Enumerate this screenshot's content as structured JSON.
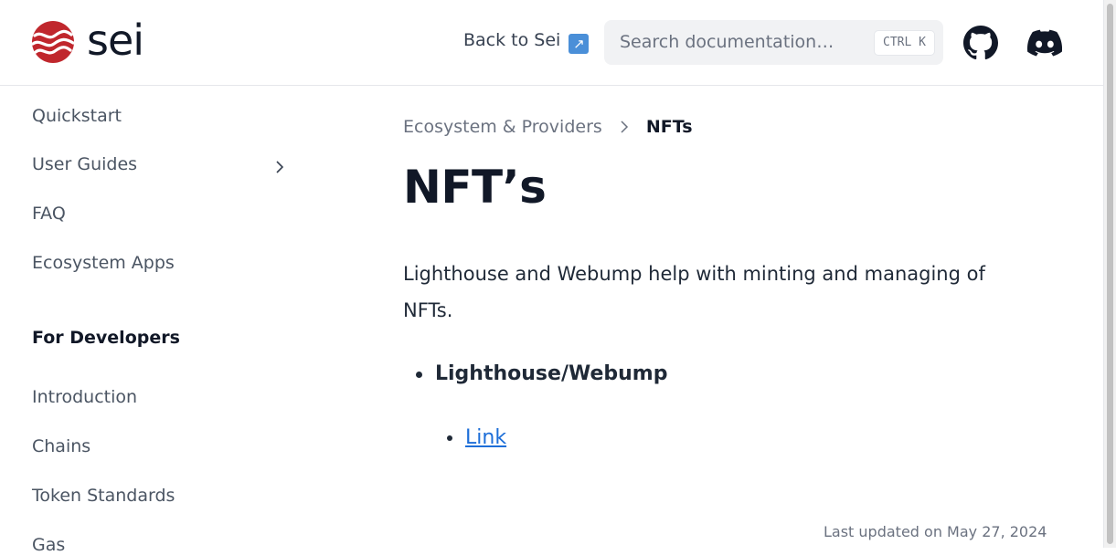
{
  "header": {
    "brand": "sei",
    "back_link": "Back to Sei",
    "back_link_icon": "↗",
    "search": {
      "placeholder": "Search documentation…",
      "shortcut": "CTRL K"
    },
    "icons": [
      "sei-logo-icon",
      "github-icon",
      "discord-icon"
    ]
  },
  "sidebar": {
    "items": [
      {
        "label": "Quickstart"
      },
      {
        "label": "User Guides",
        "expandable": true
      },
      {
        "label": "FAQ"
      },
      {
        "label": "Ecosystem Apps"
      }
    ],
    "section_heading": "For Developers",
    "dev_items": [
      {
        "label": "Introduction"
      },
      {
        "label": "Chains"
      },
      {
        "label": "Token Standards"
      },
      {
        "label": "Gas"
      }
    ]
  },
  "main": {
    "breadcrumb": {
      "parent": "Ecosystem & Providers",
      "current": "NFTs"
    },
    "title": "NFT’s",
    "paragraph": "Lighthouse and Webump help with minting and managing of NFTs.",
    "list": {
      "item": "Lighthouse/Webump",
      "sub_item_link": "Link"
    },
    "last_updated": "Last updated on May 27, 2024"
  },
  "colors": {
    "brand_red": "#c0272d",
    "link_blue": "#1d6ed8",
    "text_dark": "#111827",
    "text_muted": "#6b7280"
  }
}
